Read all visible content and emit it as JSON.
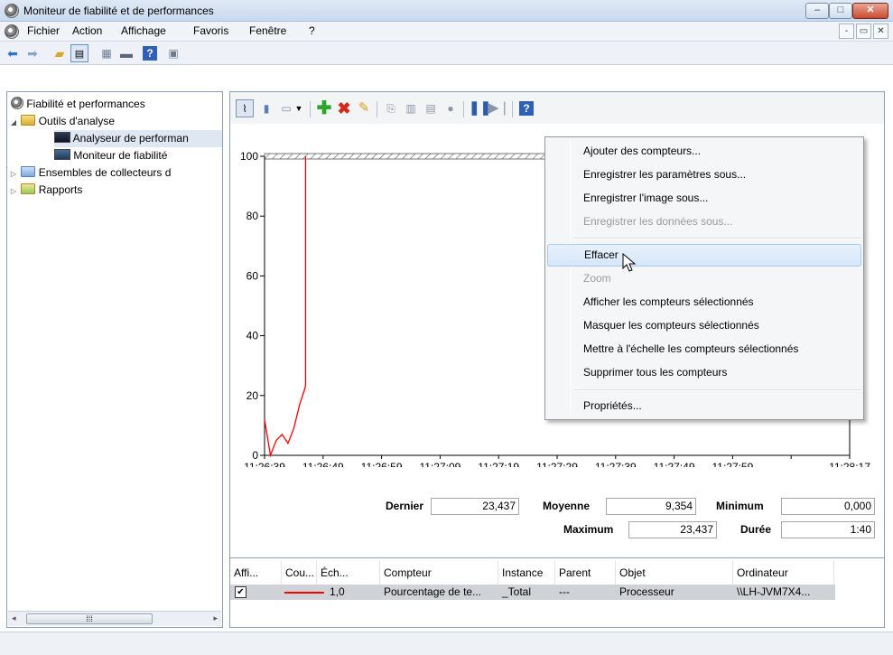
{
  "window": {
    "title": "Moniteur de fiabilité et de performances",
    "controls": {
      "min": "–",
      "max": "□",
      "close": "✕"
    }
  },
  "menubar": {
    "items": [
      "Fichier",
      "Action",
      "Affichage",
      "Favoris",
      "Fenêtre",
      "?"
    ],
    "mdi": {
      "min": "-",
      "restore": "▭",
      "close": "✕"
    }
  },
  "tree": {
    "items": [
      {
        "label": "Fiabilité et performances"
      },
      {
        "label": "Outils d'analyse"
      },
      {
        "label": "Analyseur de performan"
      },
      {
        "label": "Moniteur de fiabilité"
      },
      {
        "label": "Ensembles de collecteurs d"
      },
      {
        "label": "Rapports"
      }
    ]
  },
  "colors": {
    "accent": "#ff0000",
    "selection": "#dfe7f3"
  },
  "stats": {
    "dernier_label": "Dernier",
    "dernier": "23,437",
    "moyenne_label": "Moyenne",
    "moyenne": "9,354",
    "minimum_label": "Minimum",
    "minimum": "0,000",
    "maximum_label": "Maximum",
    "maximum": "23,437",
    "duree_label": "Durée",
    "duree": "1:40"
  },
  "legend": {
    "headers": [
      "Affi...",
      "Cou...",
      "Éch...",
      "Compteur",
      "Instance",
      "Parent",
      "Objet",
      "Ordinateur"
    ],
    "row": {
      "show": "✔",
      "scale": "1,0",
      "counter": "Pourcentage de te...",
      "instance": "_Total",
      "parent": "---",
      "object": "Processeur",
      "computer": "\\\\LH-JVM7X4..."
    }
  },
  "context_menu": {
    "items": [
      {
        "label": "Ajouter des compteurs...",
        "disabled": false
      },
      {
        "label": "Enregistrer les paramètres sous...",
        "disabled": false
      },
      {
        "label": "Enregistrer l'image sous...",
        "disabled": false
      },
      {
        "label": "Enregistrer les données sous...",
        "disabled": true
      },
      {
        "label": "Effacer",
        "disabled": false,
        "hover": true
      },
      {
        "label": "Zoom",
        "disabled": true
      },
      {
        "label": "Afficher les compteurs sélectionnés",
        "disabled": false
      },
      {
        "label": "Masquer les compteurs sélectionnés",
        "disabled": false
      },
      {
        "label": "Mettre à l'échelle les compteurs sélectionnés",
        "disabled": false
      },
      {
        "label": "Supprimer tous les compteurs",
        "disabled": false
      },
      {
        "label": "Propriétés...",
        "disabled": false
      }
    ]
  },
  "chart_data": {
    "type": "line",
    "title": "",
    "xlabel": "",
    "ylabel": "",
    "ylim": [
      0,
      100
    ],
    "yticks": [
      "0",
      "20",
      "40",
      "60",
      "80",
      "100"
    ],
    "xticks": [
      "11:26:39",
      "11:26:49",
      "11:26:59",
      "11:27:09",
      "11:27:19",
      "11:27:29",
      "11:27:39",
      "11:27:49",
      "11:27:59",
      "...",
      "11:28:17"
    ],
    "series": [
      {
        "values": [
          {
            "x": "11:26:39",
            "y": 12
          },
          {
            "x": "11:26:40",
            "y": 0
          },
          {
            "x": "11:26:41",
            "y": 5
          },
          {
            "x": "11:26:42",
            "y": 7
          },
          {
            "x": "11:26:43",
            "y": 4
          },
          {
            "x": "11:26:44",
            "y": 9
          },
          {
            "x": "11:26:45",
            "y": 17
          },
          {
            "x": "11:26:46",
            "y": 23
          },
          {
            "x": "11:26:46",
            "y": 100
          }
        ]
      }
    ]
  }
}
